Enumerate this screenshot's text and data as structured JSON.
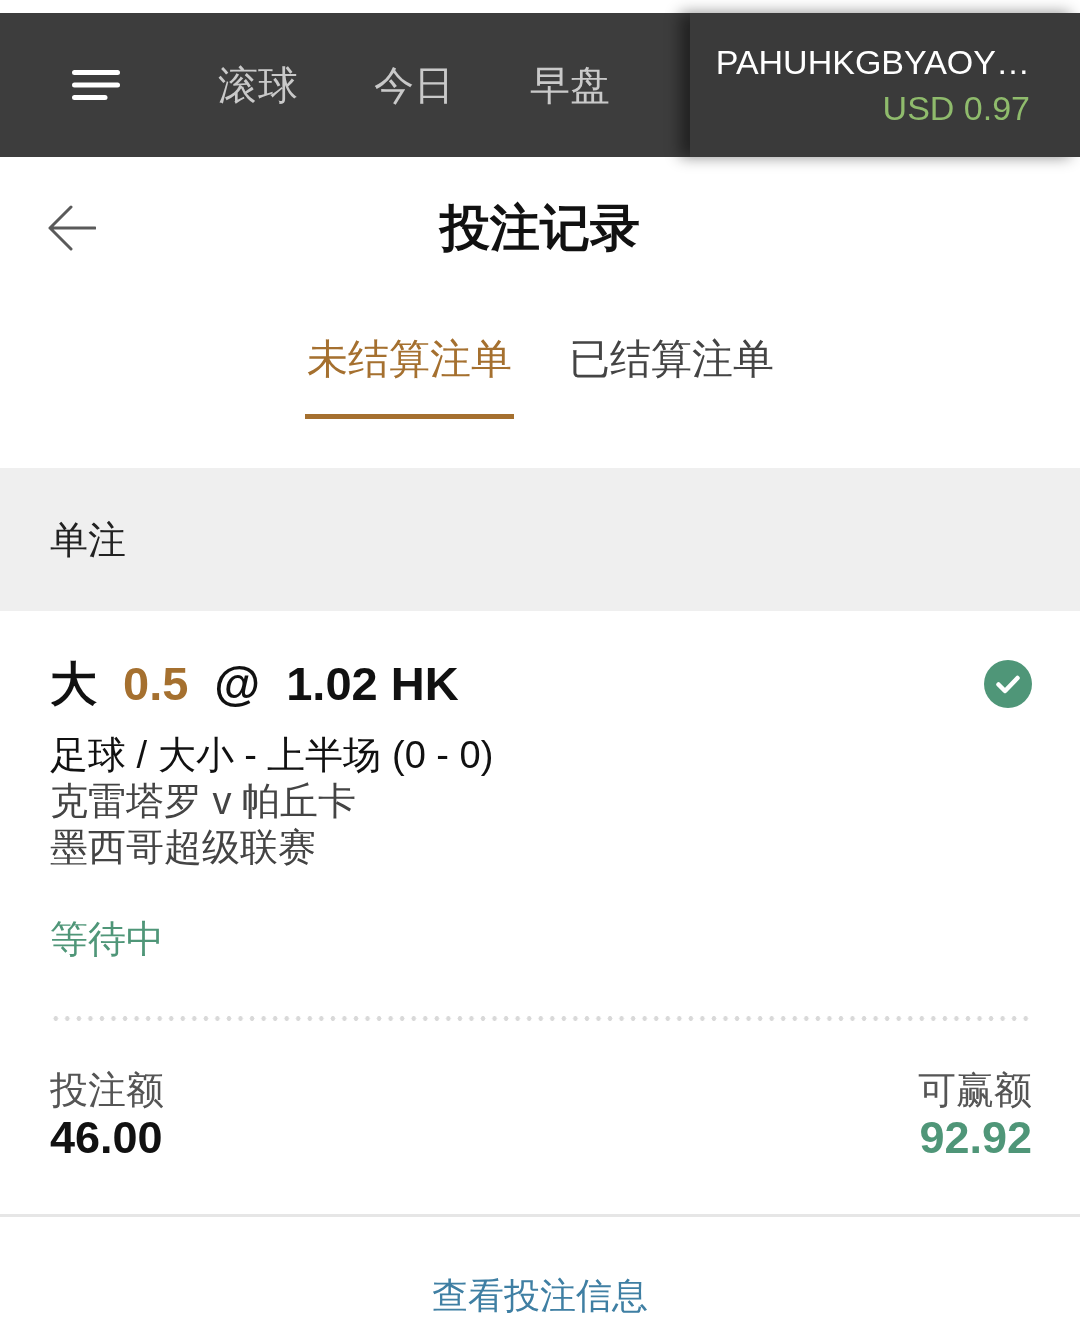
{
  "top_bar": {
    "nav": [
      {
        "label": "滚球",
        "selected": false
      },
      {
        "label": "今日",
        "selected": false
      },
      {
        "label": "早盘",
        "selected": false
      }
    ],
    "account": {
      "username": "PAHUHKGBYAOY…",
      "balance": "USD 0.97"
    }
  },
  "header": {
    "title": "投注记录"
  },
  "tabs": [
    {
      "label": "未结算注单",
      "selected": true
    },
    {
      "label": "已结算注单",
      "selected": false
    }
  ],
  "section": {
    "title": "单注"
  },
  "bets": [
    {
      "selection": "大",
      "handicap": "0.5",
      "at": "@",
      "odds": "1.02 HK",
      "market": "足球 / 大小 - 上半场 (0 - 0)",
      "match": "克雷塔罗 v 帕丘卡",
      "league": "墨西哥超级联赛",
      "status": "等待中",
      "stake_label": "投注额",
      "stake": "46.00",
      "payout_label": "可赢额",
      "payout": "92.92"
    }
  ],
  "link": {
    "label": "查看投注信息"
  }
}
